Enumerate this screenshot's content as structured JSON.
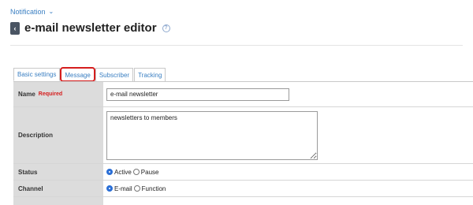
{
  "breadcrumb": {
    "label": "Notification"
  },
  "header": {
    "title": "e-mail newsletter editor"
  },
  "tabs": [
    {
      "label": "Basic settings",
      "active": true
    },
    {
      "label": "Message",
      "highlighted": true
    },
    {
      "label": "Subscriber"
    },
    {
      "label": "Tracking"
    }
  ],
  "form": {
    "name": {
      "label": "Name",
      "required_label": "Required",
      "value": "e-mail newsletter"
    },
    "description": {
      "label": "Description",
      "value": "newsletters to members"
    },
    "status": {
      "label": "Status",
      "options": [
        "Active",
        "Pause"
      ],
      "selected": "Active"
    },
    "channel": {
      "label": "Channel",
      "options": [
        "E-mail",
        "Function"
      ],
      "selected": "E-mail"
    }
  },
  "colors": {
    "link": "#3a7fc2",
    "required": "#d51e1e",
    "highlight": "#d51e1e",
    "label_bg": "#dcdcdc"
  },
  "icons": {
    "breadcrumb": "chevron-down-icon",
    "back": "chevron-left-icon",
    "help": "question-circle-icon"
  }
}
